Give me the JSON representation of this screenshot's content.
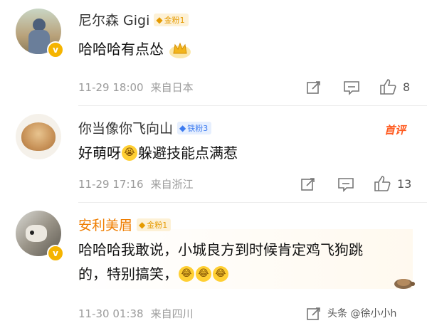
{
  "comments": [
    {
      "name": "尼尔森 Gigi",
      "fan_badge": "金粉1",
      "badge_type": "gold",
      "text": "哈哈哈有点怂",
      "time": "11-29 18:00",
      "location": "来自日本",
      "likes": "8"
    },
    {
      "name": "你当像你飞向山",
      "fan_badge": "铁粉3",
      "badge_type": "blue",
      "hot_label": "首评",
      "text_before": "好萌呀",
      "text_after": "躲避技能点满惹",
      "time": "11-29 17:16",
      "location": "来自浙江",
      "likes": "13"
    },
    {
      "name": "安利美眉",
      "fan_badge": "金粉1",
      "badge_type": "gold",
      "text_line1": "哈哈哈我敢说，小城良方到时候肯定鸡飞狗跳",
      "text_line2": "的，特别搞笑，",
      "time": "11-30 01:38",
      "location": "来自四川"
    }
  ],
  "watermark": "头条 @徐小小h",
  "colors": {
    "vip_orange": "#ef7d00",
    "hot_red": "#ff5a1f",
    "gold_badge": "#e59a00",
    "blue_badge": "#3d7bf0"
  }
}
